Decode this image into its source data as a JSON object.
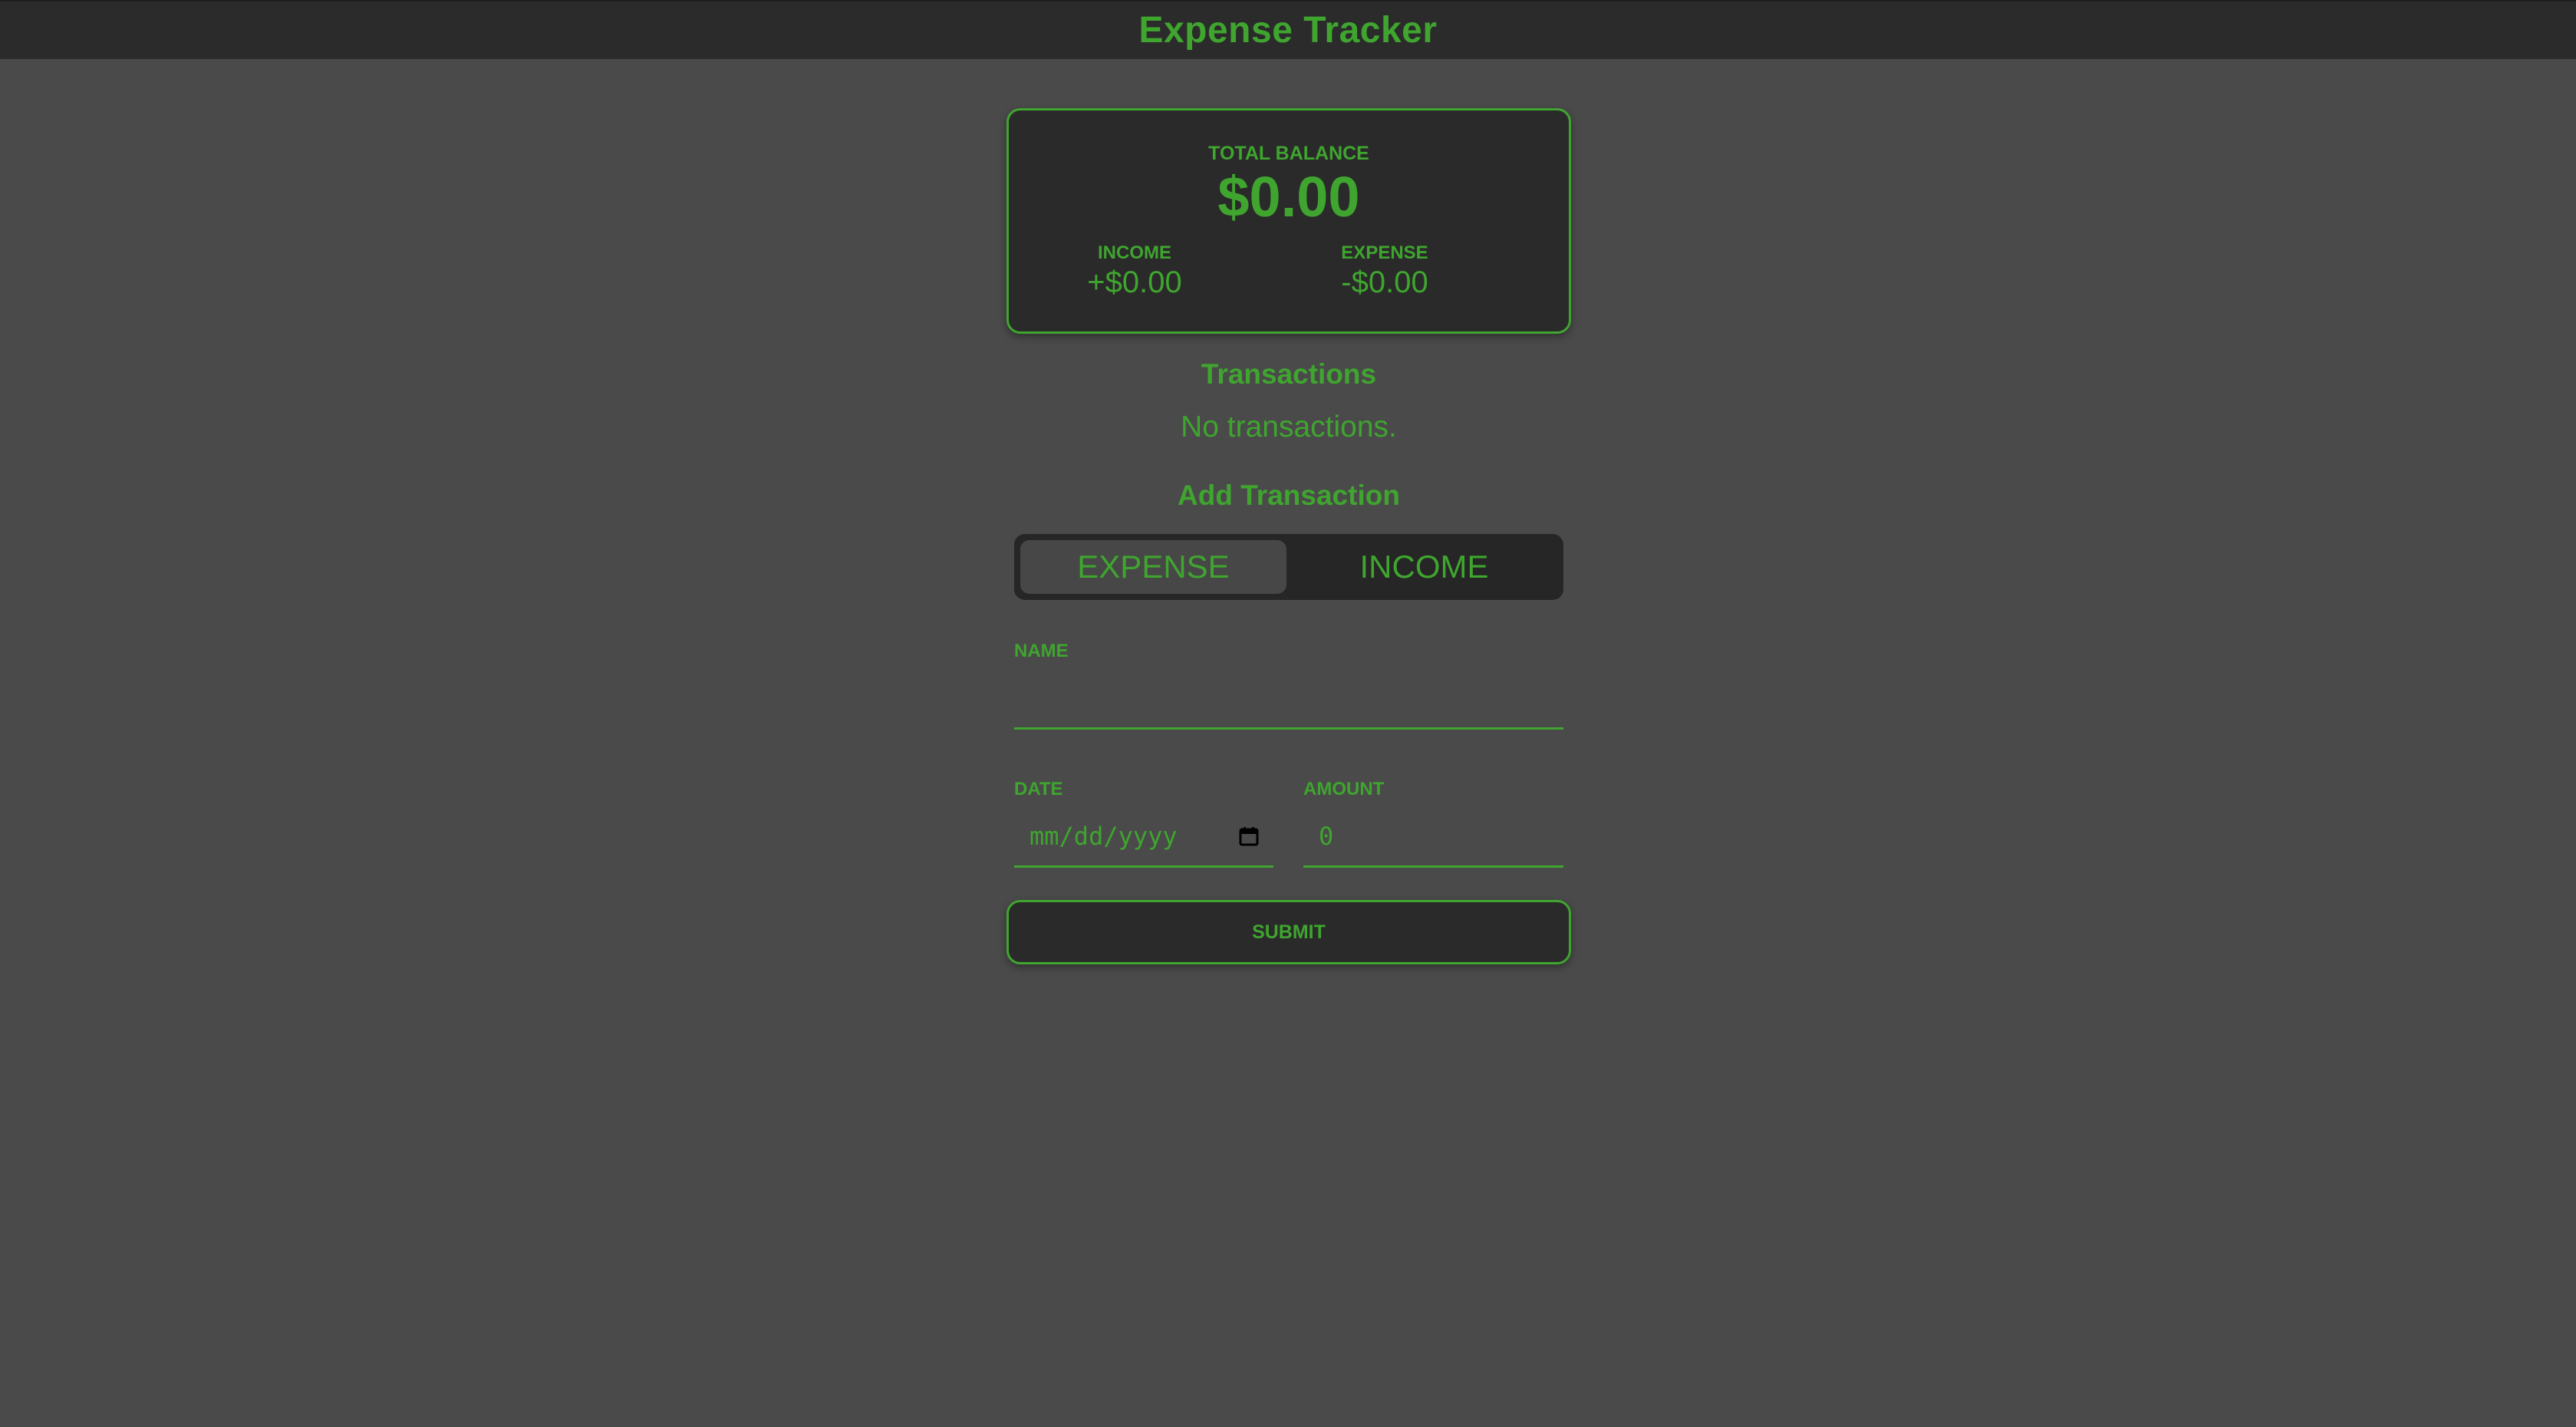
{
  "header": {
    "title": "Expense Tracker"
  },
  "balance": {
    "label": "TOTAL BALANCE",
    "value": "$0.00",
    "income_label": "INCOME",
    "income_value": "+$0.00",
    "expense_label": "EXPENSE",
    "expense_value": "-$0.00"
  },
  "transactions": {
    "title": "Transactions",
    "empty_text": "No transactions."
  },
  "form": {
    "title": "Add Transaction",
    "type_options": [
      "EXPENSE",
      "INCOME"
    ],
    "selected_type": "EXPENSE",
    "name_label": "NAME",
    "name_value": "",
    "date_label": "DATE",
    "date_placeholder": "mm/dd/yyyy",
    "amount_label": "AMOUNT",
    "amount_placeholder": "0",
    "submit_label": "SUBMIT"
  },
  "icons": {
    "date_picker": "calendar-icon"
  },
  "colors": {
    "accent": "#3fa52f",
    "background": "#4a4a4a",
    "header_bg": "#2b2b2b",
    "card_bg": "#2a2a2a"
  }
}
